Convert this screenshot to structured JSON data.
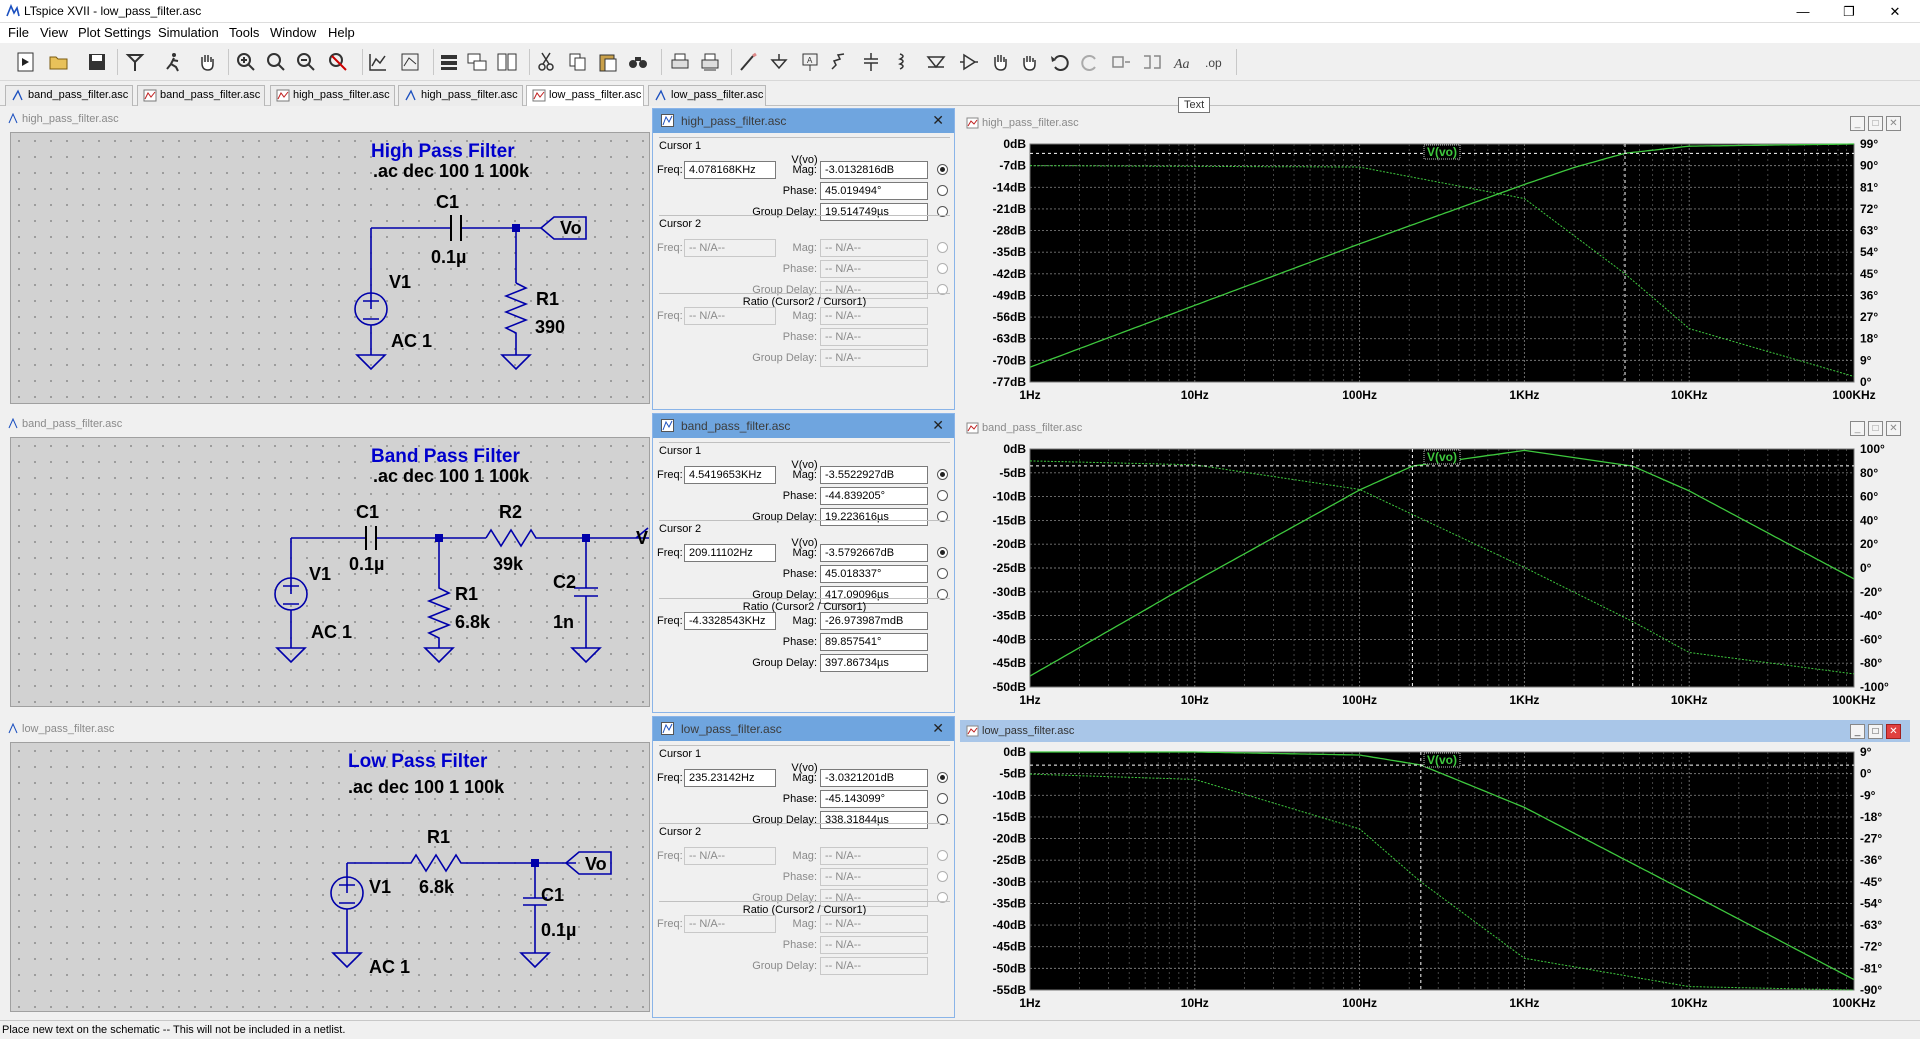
{
  "window": {
    "title": "LTspice XVII - low_pass_filter.asc",
    "minimize": "—",
    "maximize": "❐",
    "close": "✕"
  },
  "menu": [
    "File",
    "View",
    "Plot Settings",
    "Simulation",
    "Tools",
    "Window",
    "Help"
  ],
  "tabs": [
    {
      "label": "band_pass_filter.asc",
      "kind": "schematic"
    },
    {
      "label": "band_pass_filter.asc",
      "kind": "plot"
    },
    {
      "label": "high_pass_filter.asc",
      "kind": "plot"
    },
    {
      "label": "high_pass_filter.asc",
      "kind": "schematic"
    },
    {
      "label": "low_pass_filter.asc",
      "kind": "plot",
      "active": true
    },
    {
      "label": "low_pass_filter.asc",
      "kind": "schematic"
    }
  ],
  "tooltip": "Text",
  "schematics": {
    "high": {
      "file": "high_pass_filter.asc",
      "title": "High Pass Filter",
      "cmd": ".ac dec 100 1 100k",
      "labels": {
        "C1": "C1",
        "c1v": "0.1µ",
        "V1": "V1",
        "ac": "AC 1",
        "R1": "R1",
        "r1v": "390",
        "out": "Vo"
      }
    },
    "band": {
      "file": "band_pass_filter.asc",
      "title": "Band Pass Filter",
      "cmd": ".ac dec 100 1 100k",
      "labels": {
        "C1": "C1",
        "c1v": "0.1µ",
        "R2": "R2",
        "r2v": "39k",
        "V1": "V1",
        "ac": "AC 1",
        "R1": "R1",
        "r1v": "6.8k",
        "C2": "C2",
        "c2v": "1n",
        "out": "V"
      }
    },
    "low": {
      "file": "low_pass_filter.asc",
      "title": "Low Pass Filter",
      "cmd": ".ac dec 100 1 100k",
      "labels": {
        "R1": "R1",
        "r1v": "6.8k",
        "V1": "V1",
        "ac": "AC 1",
        "C1": "C1",
        "c1v": "0.1µ",
        "out": "Vo"
      }
    }
  },
  "cursors": {
    "labels": {
      "cursor1": "Cursor 1",
      "cursor2": "Cursor 2",
      "ratio": "Ratio (Cursor2 / Cursor1)",
      "freq": "Freq:",
      "mag": "Mag:",
      "phase": "Phase:",
      "gd": "Group Delay:",
      "trace": "V(vo)"
    },
    "high": {
      "file": "high_pass_filter.asc",
      "c1": {
        "freq": "4.078168KHz",
        "mag": "-3.0132816dB",
        "phase": "45.019494°",
        "gd": "19.514749µs"
      },
      "c2": {
        "freq": "-- N/A--",
        "mag": "-- N/A--",
        "phase": "-- N/A--",
        "gd": "-- N/A--"
      },
      "ratio": {
        "freq": "-- N/A--",
        "mag": "-- N/A--",
        "phase": "-- N/A--",
        "gd": "-- N/A--"
      }
    },
    "band": {
      "file": "band_pass_filter.asc",
      "c1": {
        "freq": "4.5419653KHz",
        "mag": "-3.5522927dB",
        "phase": "-44.839205°",
        "gd": "19.223616µs"
      },
      "c2": {
        "freq": "209.11102Hz",
        "mag": "-3.5792667dB",
        "phase": "45.018337°",
        "gd": "417.09096µs"
      },
      "ratio": {
        "freq": "-4.3328543KHz",
        "mag": "-26.973987mdB",
        "phase": "89.857541°",
        "gd": "397.86734µs"
      }
    },
    "low": {
      "file": "low_pass_filter.asc",
      "c1": {
        "freq": "235.23142Hz",
        "mag": "-3.0321201dB",
        "phase": "-45.143099°",
        "gd": "338.31844µs"
      },
      "c2": {
        "freq": "-- N/A--",
        "mag": "-- N/A--",
        "phase": "-- N/A--",
        "gd": "-- N/A--"
      },
      "ratio": {
        "freq": "-- N/A--",
        "mag": "-- N/A--",
        "phase": "-- N/A--",
        "gd": "-- N/A--"
      }
    }
  },
  "plots": {
    "high": {
      "file": "high_pass_filter.asc",
      "trace": "V(vo)"
    },
    "band": {
      "file": "band_pass_filter.asc",
      "trace": "V(vo)"
    },
    "low": {
      "file": "low_pass_filter.asc",
      "trace": "V(vo)"
    }
  },
  "chart_data": [
    {
      "type": "line",
      "title": "",
      "xlabel": "",
      "ylabel": "",
      "xscale": "log",
      "xlim": [
        1,
        100000
      ],
      "x_ticks": [
        "1Hz",
        "10Hz",
        "100Hz",
        "1KHz",
        "10KHz",
        "100KHz"
      ],
      "y_ticks": [
        "0dB",
        "-7dB",
        "-14dB",
        "-21dB",
        "-28dB",
        "-35dB",
        "-42dB",
        "-49dB",
        "-56dB",
        "-63dB",
        "-70dB",
        "-77dB"
      ],
      "y2_ticks": [
        "99°",
        "90°",
        "81°",
        "72°",
        "63°",
        "54°",
        "45°",
        "36°",
        "27°",
        "18°",
        "9°",
        "0°"
      ],
      "ylim": [
        -77,
        0
      ],
      "y2lim": [
        0,
        99
      ],
      "cursor_freq": [
        4078.168
      ],
      "cursor_level_db": -3.0132816,
      "series": [
        {
          "name": "V(vo)",
          "kind": "magnitude",
          "x": [
            1,
            10,
            100,
            1000,
            2000,
            4078,
            10000,
            100000
          ],
          "y": [
            -72.2,
            -52.2,
            -32.3,
            -13.1,
            -7.6,
            -3.0,
            -0.7,
            0
          ]
        },
        {
          "kind": "phase",
          "x": [
            1,
            100,
            1000,
            4078,
            10000,
            100000
          ],
          "y": [
            90,
            89.4,
            76.3,
            45,
            22.2,
            2.3
          ]
        }
      ]
    },
    {
      "type": "line",
      "title": "",
      "xlabel": "",
      "ylabel": "",
      "xscale": "log",
      "xlim": [
        1,
        100000
      ],
      "x_ticks": [
        "1Hz",
        "10Hz",
        "100Hz",
        "1KHz",
        "10KHz",
        "100KHz"
      ],
      "y_ticks": [
        "0dB",
        "-5dB",
        "-10dB",
        "-15dB",
        "-20dB",
        "-25dB",
        "-30dB",
        "-35dB",
        "-40dB",
        "-45dB",
        "-50dB"
      ],
      "y2_ticks": [
        "100°",
        "80°",
        "60°",
        "40°",
        "20°",
        "0°",
        "-20°",
        "-40°",
        "-60°",
        "-80°",
        "-100°"
      ],
      "ylim": [
        -50,
        0
      ],
      "y2lim": [
        -100,
        100
      ],
      "cursor_freq": [
        209.11102,
        4541.9653
      ],
      "cursor_level_db": -3.55,
      "series": [
        {
          "name": "V(vo)",
          "kind": "magnitude",
          "x": [
            1,
            10,
            100,
            209,
            1000,
            4542,
            10000,
            100000
          ],
          "y": [
            -47.7,
            -27.8,
            -8.6,
            -3.6,
            -0.3,
            -3.6,
            -8.8,
            -27.3
          ]
        },
        {
          "kind": "phase",
          "x": [
            1,
            10,
            100,
            209,
            1000,
            4542,
            10000,
            100000
          ],
          "y": [
            90,
            86.7,
            66,
            45,
            0.5,
            -45,
            -71,
            -89
          ]
        }
      ]
    },
    {
      "type": "line",
      "title": "",
      "xlabel": "",
      "ylabel": "",
      "xscale": "log",
      "xlim": [
        1,
        100000
      ],
      "x_ticks": [
        "1Hz",
        "10Hz",
        "100Hz",
        "1KHz",
        "10KHz",
        "100KHz"
      ],
      "y_ticks": [
        "0dB",
        "-5dB",
        "-10dB",
        "-15dB",
        "-20dB",
        "-25dB",
        "-30dB",
        "-35dB",
        "-40dB",
        "-45dB",
        "-50dB",
        "-55dB"
      ],
      "y2_ticks": [
        "9°",
        "0°",
        "-9°",
        "-18°",
        "-27°",
        "-36°",
        "-45°",
        "-54°",
        "-63°",
        "-72°",
        "-81°",
        "-90°"
      ],
      "ylim": [
        -55,
        0
      ],
      "y2lim": [
        -90,
        9
      ],
      "cursor_freq": [
        235.23142
      ],
      "cursor_level_db": -3.0321201,
      "series": [
        {
          "name": "V(vo)",
          "kind": "magnitude",
          "x": [
            1,
            10,
            100,
            235,
            1000,
            10000,
            100000
          ],
          "y": [
            0,
            0,
            -0.7,
            -3.0,
            -12.8,
            -32.6,
            -52.6
          ]
        },
        {
          "kind": "phase",
          "x": [
            1,
            10,
            100,
            235,
            1000,
            10000,
            100000
          ],
          "y": [
            -0.2,
            -2.4,
            -23,
            -45,
            -76.8,
            -88.6,
            -90
          ]
        }
      ]
    }
  ],
  "status": "Place new text on the schematic -- This will not be included in a netlist."
}
